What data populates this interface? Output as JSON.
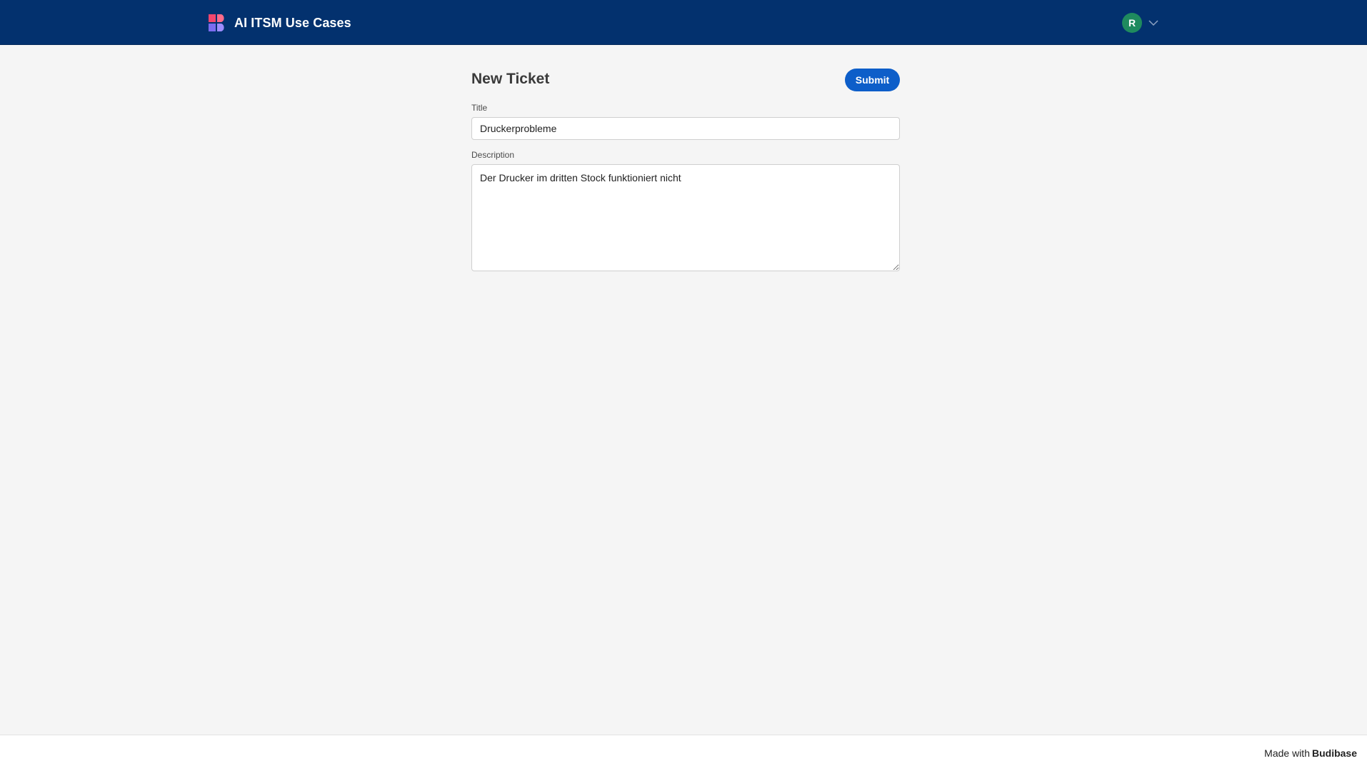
{
  "header": {
    "app_title": "AI ITSM Use Cases",
    "logo_icon": "budibase-logo-icon",
    "user_initial": "R",
    "avatar_color": "#1f8a5e",
    "bar_color": "#03316e"
  },
  "form": {
    "page_title": "New Ticket",
    "submit_label": "Submit",
    "title_label": "Title",
    "title_value": "Druckerprobleme",
    "description_label": "Description",
    "description_value": "Der Drucker im dritten Stock funktioniert nicht"
  },
  "footer": {
    "made_with": "Made with",
    "brand": "Budibase"
  }
}
